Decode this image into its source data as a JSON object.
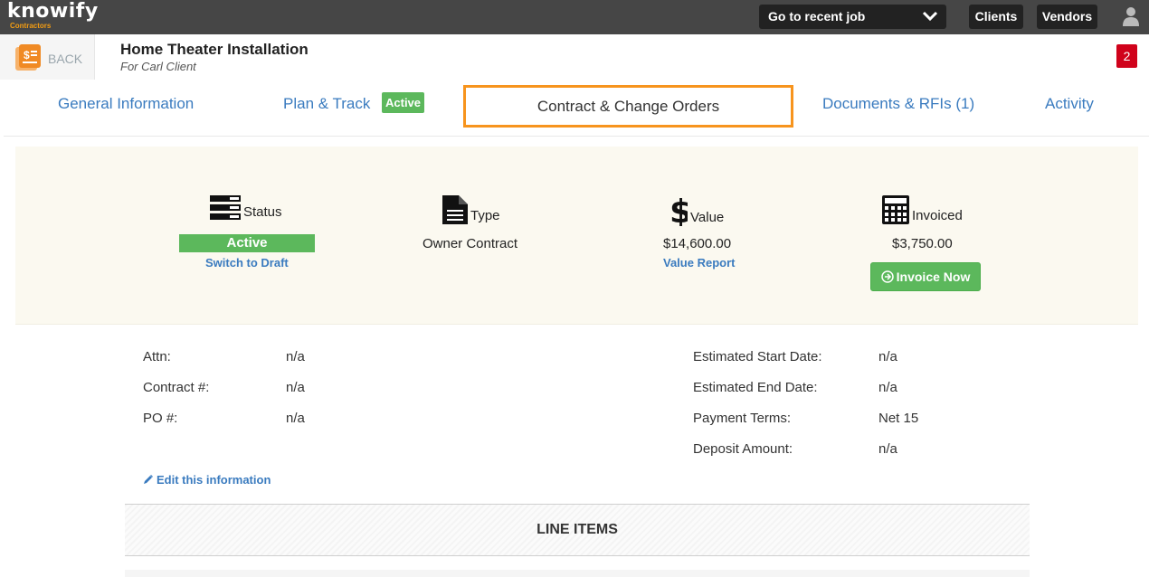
{
  "app": {
    "logo_main": "knowify",
    "logo_sub": "Contractors"
  },
  "topbar": {
    "recent_job_label": "Go to recent job",
    "clients_label": "Clients",
    "vendors_label": "Vendors"
  },
  "header": {
    "back_label": "BACK",
    "job_title": "Home Theater Installation",
    "job_subtitle": "For Carl Client",
    "notification_count": "2"
  },
  "tabs": [
    {
      "label": "General Information"
    },
    {
      "label": "Plan & Track",
      "badge": "Active"
    },
    {
      "label": "Contract & Change Orders",
      "selected": true
    },
    {
      "label": "Documents & RFIs (1)"
    },
    {
      "label": "Activity"
    }
  ],
  "summary": {
    "status": {
      "heading": "Status",
      "value": "Active",
      "link": "Switch to Draft",
      "icon": "server-icon"
    },
    "type": {
      "heading": "Type",
      "value": "Owner Contract",
      "icon": "document-icon"
    },
    "value": {
      "heading": "Value",
      "value": "$14,600.00",
      "link": "Value Report",
      "icon": "dollar-icon"
    },
    "invoiced": {
      "heading": "Invoiced",
      "value": "$3,750.00",
      "button": "Invoice Now",
      "icon": "calculator-icon"
    }
  },
  "details": {
    "left": [
      {
        "label": "Attn:",
        "value": "n/a"
      },
      {
        "label": "Contract #:",
        "value": "n/a"
      },
      {
        "label": "PO #:",
        "value": "n/a"
      }
    ],
    "right": [
      {
        "label": "Estimated Start Date:",
        "value": "n/a"
      },
      {
        "label": "Estimated End Date:",
        "value": "n/a"
      },
      {
        "label": "Payment Terms:",
        "value": "Net 15"
      },
      {
        "label": "Deposit Amount:",
        "value": "n/a"
      }
    ],
    "edit_link": "Edit this information"
  },
  "line_items": {
    "heading": "LINE ITEMS"
  },
  "colors": {
    "topbar": "#464646",
    "accent_link": "#3a7bbf",
    "active_green": "#5cb85c",
    "selected_tab_border": "#f7941d",
    "badge_red": "#d0021b"
  }
}
